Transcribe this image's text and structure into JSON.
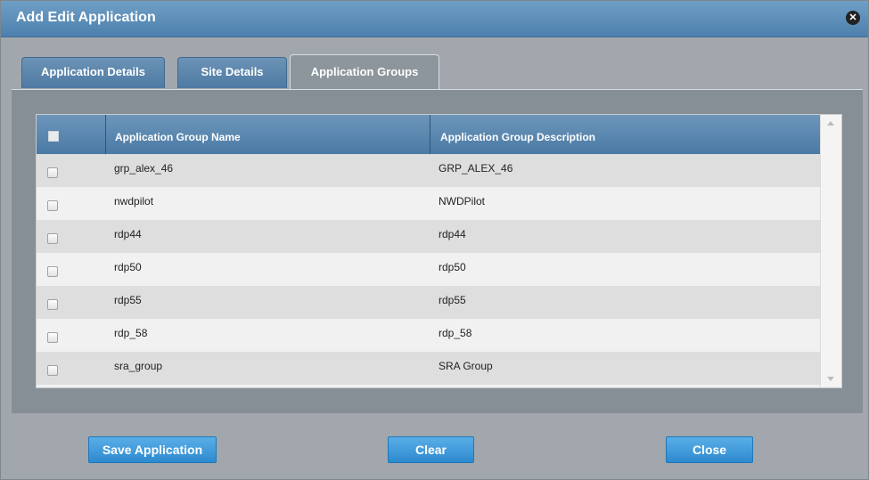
{
  "dialog": {
    "title": "Add Edit Application",
    "close_icon": "close-icon"
  },
  "tabs": [
    {
      "label": "Application Details",
      "active": false
    },
    {
      "label": "Site Details",
      "active": false
    },
    {
      "label": "Application Groups",
      "active": true
    }
  ],
  "grid": {
    "columns": [
      "Application Group Name",
      "Application Group Description"
    ],
    "rows": [
      {
        "name": "grp_alex_46",
        "description": "GRP_ALEX_46"
      },
      {
        "name": "nwdpilot",
        "description": "NWDPilot"
      },
      {
        "name": "rdp44",
        "description": "rdp44"
      },
      {
        "name": "rdp50",
        "description": "rdp50"
      },
      {
        "name": "rdp55",
        "description": "rdp55"
      },
      {
        "name": "rdp_58",
        "description": "rdp_58"
      },
      {
        "name": "sra_group",
        "description": "SRA Group"
      }
    ]
  },
  "buttons": {
    "save": "Save Application",
    "clear": "Clear",
    "close": "Close"
  },
  "colors": {
    "header_blue": "#4d80ad",
    "button_blue": "#2d8ad0"
  }
}
